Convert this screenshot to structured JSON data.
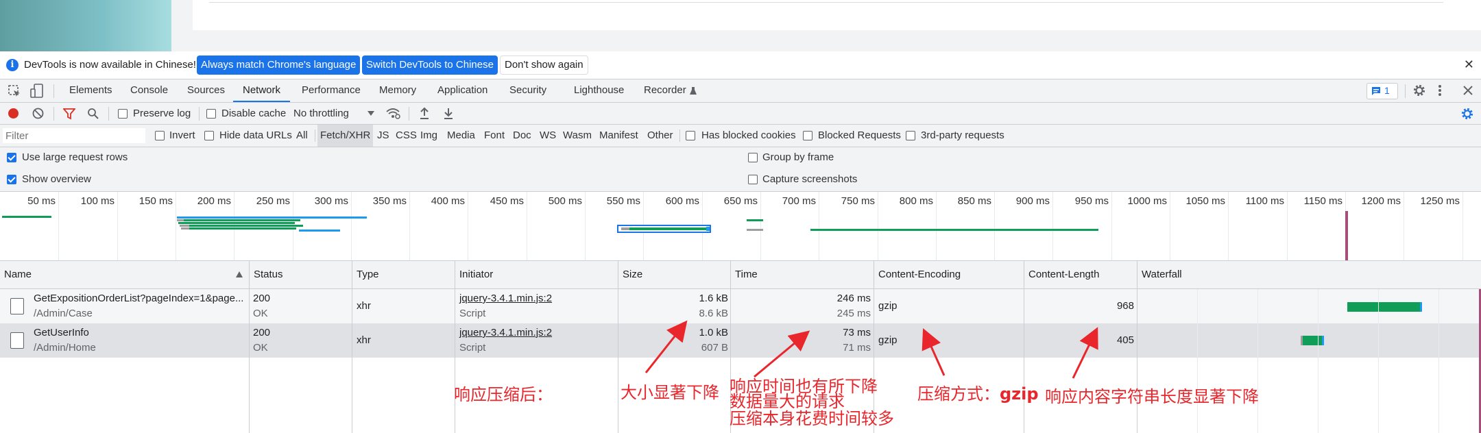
{
  "infobar": {
    "message": "DevTools is now available in Chinese!",
    "btn_match": "Always match Chrome's language",
    "btn_switch": "Switch DevTools to Chinese",
    "btn_dont_show": "Don't show again",
    "close": "✕"
  },
  "tabs": [
    {
      "label": "Elements"
    },
    {
      "label": "Console"
    },
    {
      "label": "Sources"
    },
    {
      "label": "Network"
    },
    {
      "label": "Performance"
    },
    {
      "label": "Memory"
    },
    {
      "label": "Application"
    },
    {
      "label": "Security"
    },
    {
      "label": "Lighthouse"
    },
    {
      "label": "Recorder"
    }
  ],
  "issues_badge": "1",
  "toolbar": {
    "preserve_log": "Preserve log",
    "disable_cache": "Disable cache",
    "throttling": "No throttling"
  },
  "filter": {
    "placeholder": "Filter",
    "invert": "Invert",
    "hide_data_urls": "Hide data URLs",
    "types": [
      "All",
      "Fetch/XHR",
      "JS",
      "CSS",
      "Img",
      "Media",
      "Font",
      "Doc",
      "WS",
      "Wasm",
      "Manifest",
      "Other"
    ],
    "has_blocked_cookies": "Has blocked cookies",
    "blocked_requests": "Blocked Requests",
    "third_party": "3rd-party requests"
  },
  "options": {
    "large_rows": "Use large request rows",
    "show_overview": "Show overview",
    "group_by_frame": "Group by frame",
    "capture_screenshots": "Capture screenshots"
  },
  "overview_ticks": [
    "50 ms",
    "100 ms",
    "150 ms",
    "200 ms",
    "250 ms",
    "300 ms",
    "350 ms",
    "400 ms",
    "450 ms",
    "500 ms",
    "550 ms",
    "600 ms",
    "650 ms",
    "700 ms",
    "750 ms",
    "800 ms",
    "850 ms",
    "900 ms",
    "950 ms",
    "1000 ms",
    "1050 ms",
    "1100 ms",
    "1150 ms",
    "1200 ms",
    "1250 ms"
  ],
  "columns": [
    "Name",
    "Status",
    "Type",
    "Initiator",
    "Size",
    "Time",
    "Content-Encoding",
    "Content-Length",
    "Waterfall"
  ],
  "rows": [
    {
      "name": "GetExpositionOrderList?pageIndex=1&page...",
      "path": "/Admin/Case",
      "status": "200",
      "status_text": "OK",
      "type": "xhr",
      "initiator": "jquery-3.4.1.min.js:2",
      "initiator_type": "Script",
      "size": "1.6 kB",
      "resource_size": "8.6 kB",
      "time": "246 ms",
      "latency": "245 ms",
      "encoding": "gzip",
      "length": "968"
    },
    {
      "name": "GetUserInfo",
      "path": "/Admin/Home",
      "status": "200",
      "status_text": "OK",
      "type": "xhr",
      "initiator": "jquery-3.4.1.min.js:2",
      "initiator_type": "Script",
      "size": "1.0 kB",
      "resource_size": "607 B",
      "time": "73 ms",
      "latency": "71 ms",
      "encoding": "gzip",
      "length": "405"
    }
  ],
  "annotations": {
    "after_compress": "响应压缩后：",
    "size_drop": "大小显著下降",
    "time_1": "响应时间也有所下降",
    "time_2": "数据量大的请求",
    "time_3": "压缩本身花费时间较多",
    "enc_label": "压缩方式：",
    "enc_value": "gzip",
    "length_drop": "响应内容字符串长度显著下降"
  },
  "colors": {
    "accent": "#1a73e8",
    "annotation": "#e8262b",
    "waterfall_green": "#0f9d58",
    "waterfall_blue": "#1a9bf0"
  }
}
